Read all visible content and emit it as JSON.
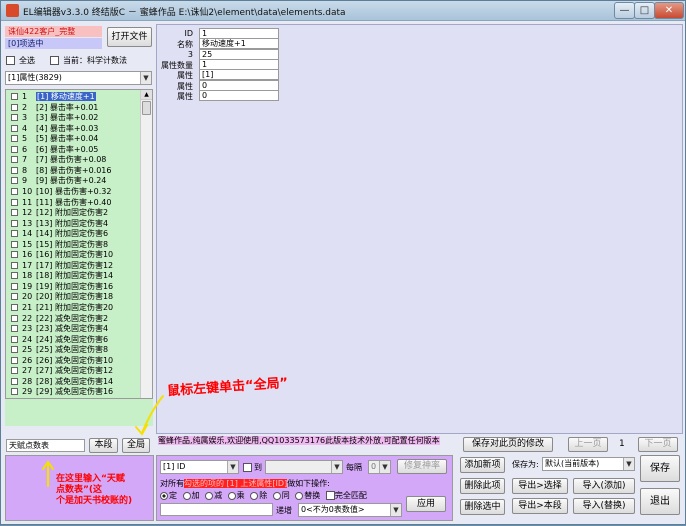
{
  "window": {
    "title": "EL编辑器v3.3.0 终结版C － 蜜蜂作品 E:\\诛仙2\\element\\data\\elements.data",
    "min_glyph": "—",
    "max_glyph": "□",
    "close_glyph": "✕"
  },
  "left": {
    "client_name": "诛仙422客户_完整",
    "selected_count": "[0]项选中",
    "open_file_label": "打开文件",
    "select_all_label": "全选",
    "current_label": "当前：科学计数法",
    "category_selected": "[1]属性(3829)"
  },
  "list": {
    "rows": [
      {
        "id": "1",
        "name": "[1] 移动速度+1",
        "selected": true
      },
      {
        "id": "2",
        "name": "[2] 暴击率+0.01"
      },
      {
        "id": "3",
        "name": "[3] 暴击率+0.02"
      },
      {
        "id": "4",
        "name": "[4] 暴击率+0.03"
      },
      {
        "id": "5",
        "name": "[5] 暴击率+0.04"
      },
      {
        "id": "6",
        "name": "[6] 暴击率+0.05"
      },
      {
        "id": "7",
        "name": "[7] 暴击伤害+0.08"
      },
      {
        "id": "8",
        "name": "[8] 暴击伤害+0.016"
      },
      {
        "id": "9",
        "name": "[9] 暴击伤害+0.24"
      },
      {
        "id": "10",
        "name": "[10] 暴击伤害+0.32"
      },
      {
        "id": "11",
        "name": "[11] 暴击伤害+0.40"
      },
      {
        "id": "12",
        "name": "[12] 附加固定伤害2"
      },
      {
        "id": "13",
        "name": "[13] 附加固定伤害4"
      },
      {
        "id": "14",
        "name": "[14] 附加固定伤害6"
      },
      {
        "id": "15",
        "name": "[15] 附加固定伤害8"
      },
      {
        "id": "16",
        "name": "[16] 附加固定伤害10"
      },
      {
        "id": "17",
        "name": "[17] 附加固定伤害12"
      },
      {
        "id": "18",
        "name": "[18] 附加固定伤害14"
      },
      {
        "id": "19",
        "name": "[19] 附加固定伤害16"
      },
      {
        "id": "20",
        "name": "[20] 附加固定伤害18"
      },
      {
        "id": "21",
        "name": "[21] 附加固定伤害20"
      },
      {
        "id": "22",
        "name": "[22] 减免固定伤害2"
      },
      {
        "id": "23",
        "name": "[23] 减免固定伤害4"
      },
      {
        "id": "24",
        "name": "[24] 减免固定伤害6"
      },
      {
        "id": "25",
        "name": "[25] 减免固定伤害8"
      },
      {
        "id": "26",
        "name": "[26] 减免固定伤害10"
      },
      {
        "id": "27",
        "name": "[27] 减免固定伤害12"
      },
      {
        "id": "28",
        "name": "[28] 减免固定伤害14"
      },
      {
        "id": "29",
        "name": "[29] 减免固定伤害16"
      }
    ]
  },
  "fields": [
    {
      "label": "ID",
      "value": "1"
    },
    {
      "label": "名称",
      "value": "移动速度+1"
    },
    {
      "label": "3",
      "value": "25"
    },
    {
      "label": "属性数量",
      "value": "1"
    },
    {
      "label": "属性",
      "value": "[1]"
    },
    {
      "label": "属性",
      "value": "0"
    },
    {
      "label": "属性",
      "value": "0"
    }
  ],
  "search": {
    "value": "天赋点数表",
    "this_section_label": "本段",
    "global_label": "全局"
  },
  "status": {
    "text": "蜜蜂作品,纯属娱乐,欢迎使用,QQ1033573176此版本技术外放,可配置任何版本",
    "save_compare_label": "保存对此页的修改",
    "prev_label": "上一页",
    "page_num": "1",
    "next_label": "下一页"
  },
  "bulk": {
    "field_select": "[1] ID",
    "to_label": "到",
    "every_label": "每隔",
    "every_value": "0",
    "fix_label": "修复神率",
    "desc_prefix": "对所有",
    "desc_hl1": "勾选的项",
    "desc_hl2": "的 [1] 上述属性",
    "desc_hl3": "[ID]",
    "desc_suffix": "做如下操作:",
    "ops": [
      "定",
      "加",
      "减",
      "乘",
      "除",
      "同",
      "替换",
      "完全匹配"
    ],
    "apply_label": "应用",
    "inc_label": "递增",
    "inc_select": "0<不为0表数值>"
  },
  "actions": {
    "add_new": "添加新项",
    "delete_item": "删除此项",
    "delete_selected": "删除选中",
    "save_as_label": "保存为:",
    "save_as_select": "默认(当前版本)",
    "save_label": "保存",
    "export_select": "导出>选择",
    "import_add": "导入(添加)",
    "export_section": "导出>本段",
    "import_replace": "导入(替换)",
    "exit_label": "退出"
  },
  "annotations": {
    "top": "鼠标左键单击“全局”",
    "bottom_line1": "在这里输入“天赋",
    "bottom_line2": "点数表”(这",
    "bottom_line3": "个是加天书校账的)"
  },
  "colors": {
    "list_bg": "#c8f0c8",
    "panel_purple": "#d4a8f8",
    "editor_bg": "#e0e0f4",
    "highlight_red": "#ff2020",
    "annotation_yellow": "#f5e000"
  }
}
